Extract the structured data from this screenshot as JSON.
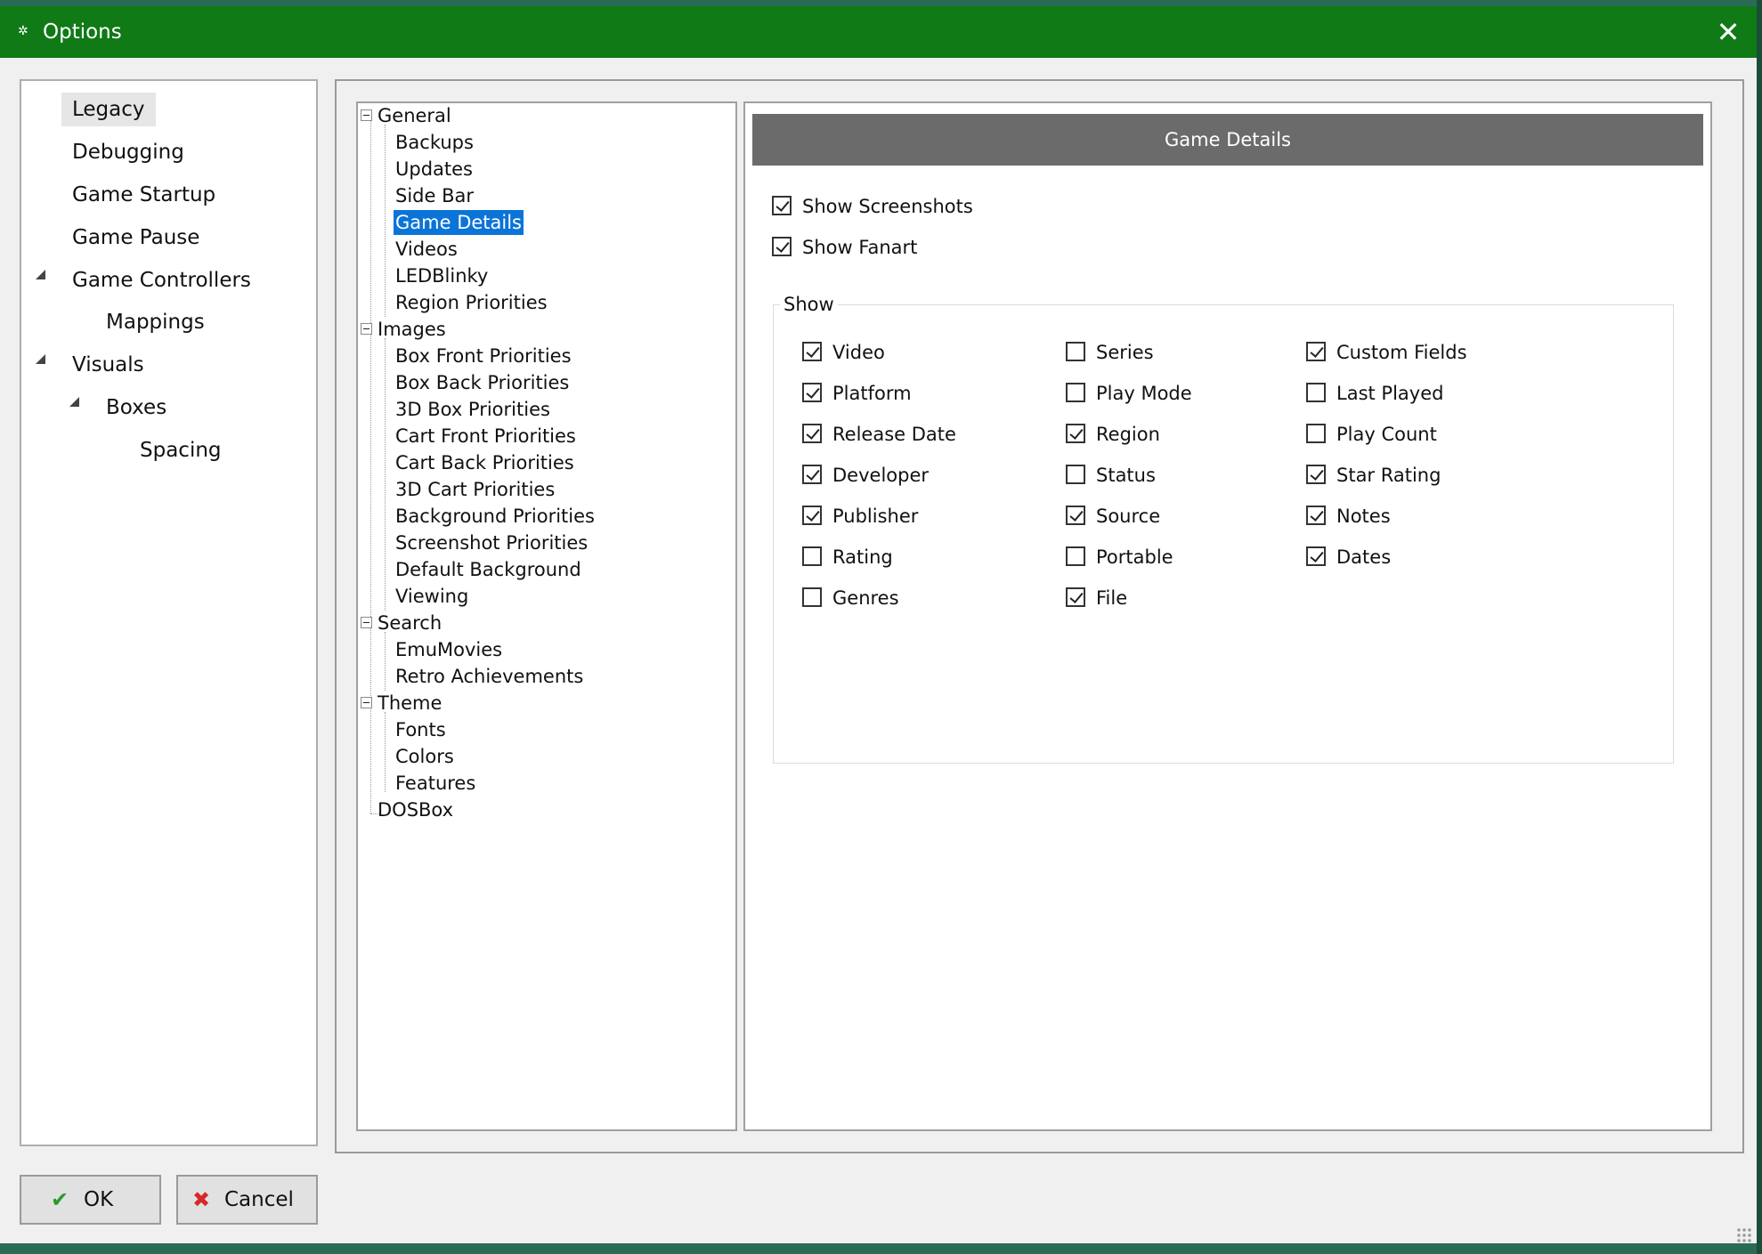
{
  "window": {
    "title": "Options",
    "close_glyph": "✕",
    "gear_glyph": "✲"
  },
  "left_tree": {
    "items": [
      {
        "label": "Legacy",
        "selected": true
      },
      {
        "label": "Debugging"
      },
      {
        "label": "Game Startup"
      },
      {
        "label": "Game Pause"
      },
      {
        "label": "Game Controllers",
        "expanded": true
      },
      {
        "label": "Mappings"
      },
      {
        "label": "Visuals",
        "expanded": true
      },
      {
        "label": "Boxes",
        "expanded": true
      },
      {
        "label": "Spacing"
      }
    ]
  },
  "mid_tree": {
    "groups": [
      {
        "label": "General",
        "children": [
          "Backups",
          "Updates",
          "Side Bar",
          "Game Details",
          "Videos",
          "LEDBlinky",
          "Region Priorities"
        ]
      },
      {
        "label": "Images",
        "children": [
          "Box Front Priorities",
          "Box Back Priorities",
          "3D Box Priorities",
          "Cart Front Priorities",
          "Cart Back Priorities",
          "3D Cart Priorities",
          "Background Priorities",
          "Screenshot Priorities",
          "Default Background",
          "Viewing"
        ]
      },
      {
        "label": "Search",
        "children": [
          "EmuMovies",
          "Retro Achievements"
        ]
      },
      {
        "label": "Theme",
        "children": [
          "Fonts",
          "Colors",
          "Features"
        ]
      },
      {
        "label": "DOSBox",
        "children": []
      }
    ],
    "selected": "Game Details"
  },
  "details": {
    "header": "Game Details",
    "show_screenshots": {
      "label": "Show Screenshots",
      "checked": true
    },
    "show_fanart": {
      "label": "Show Fanart",
      "checked": true
    },
    "group_label": "Show",
    "columns": [
      [
        {
          "label": "Video",
          "checked": true
        },
        {
          "label": "Platform",
          "checked": true
        },
        {
          "label": "Release Date",
          "checked": true
        },
        {
          "label": "Developer",
          "checked": true
        },
        {
          "label": "Publisher",
          "checked": true
        },
        {
          "label": "Rating",
          "checked": false
        },
        {
          "label": "Genres",
          "checked": false
        }
      ],
      [
        {
          "label": "Series",
          "checked": false
        },
        {
          "label": "Play Mode",
          "checked": false
        },
        {
          "label": "Region",
          "checked": true
        },
        {
          "label": "Status",
          "checked": false
        },
        {
          "label": "Source",
          "checked": true
        },
        {
          "label": "Portable",
          "checked": false
        },
        {
          "label": "File",
          "checked": true
        }
      ],
      [
        {
          "label": "Custom Fields",
          "checked": true
        },
        {
          "label": "Last Played",
          "checked": false
        },
        {
          "label": "Play Count",
          "checked": false
        },
        {
          "label": "Star Rating",
          "checked": true
        },
        {
          "label": "Notes",
          "checked": true
        },
        {
          "label": "Dates",
          "checked": true
        }
      ]
    ]
  },
  "buttons": {
    "ok": {
      "label": "OK",
      "icon_glyph": "✔"
    },
    "cancel": {
      "label": "Cancel",
      "icon_glyph": "✖"
    }
  },
  "colors": {
    "titlebar": "#0f7a16",
    "header_bg": "#6b6b6b",
    "selection": "#0a74d8",
    "ok_icon": "#2a9a2a",
    "cancel_icon": "#d42a2a"
  }
}
